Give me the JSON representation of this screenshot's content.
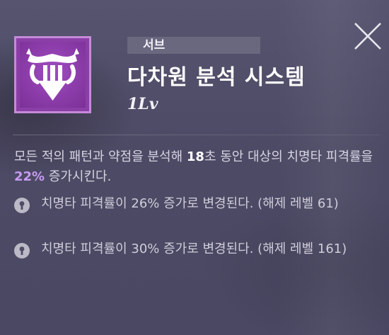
{
  "skill": {
    "category": "서브",
    "name": "다차원 분석 시스템",
    "level": "1Lv",
    "icon": "shield-arrow-down-icon",
    "icon_color": "#8a3fa6"
  },
  "description": {
    "part1": "모든 적의 패턴과 약점을 분석해 ",
    "duration": "18",
    "part2": "초 동안 대상의 치명타 피격률을 ",
    "value": "22%",
    "part3": " 증가시킨다."
  },
  "unlocks": [
    {
      "text": "치명타 피격률이 26% 증가로 변경된다. (해제 레벨 61)",
      "icon": "lock-icon"
    },
    {
      "text": "치명타 피격률이 30% 증가로 변경된다. (해제 레벨 161)",
      "icon": "lock-icon"
    }
  ],
  "close_icon": "close-icon"
}
